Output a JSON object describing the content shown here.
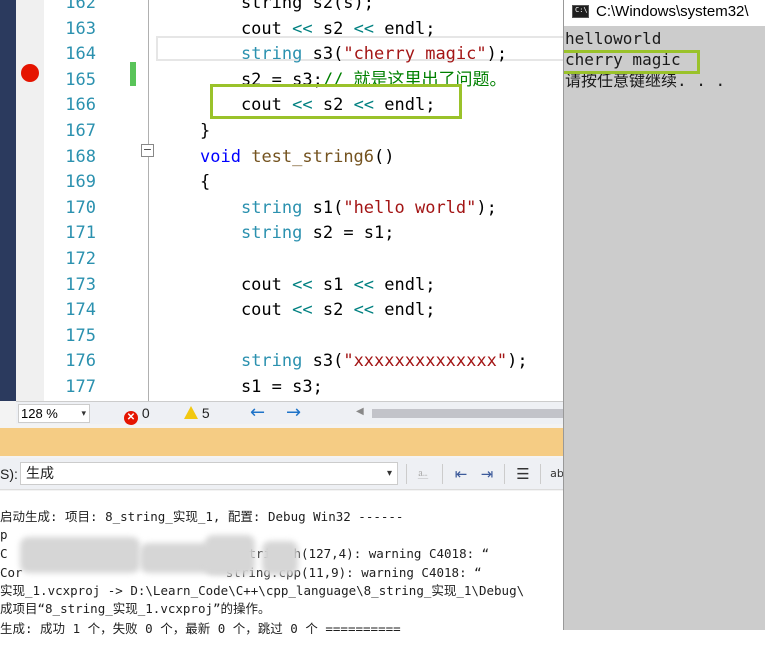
{
  "editor": {
    "line_numbers": [
      "162",
      "163",
      "164",
      "165",
      "166",
      "167",
      "168",
      "169",
      "170",
      "171",
      "172",
      "173",
      "174",
      "175",
      "176",
      "177"
    ],
    "lines": [
      [
        {
          "t": "    string s2(s);",
          "c": "cut"
        }
      ],
      [
        {
          "t": "    cout ",
          "c": ""
        },
        {
          "t": "<<",
          "c": "op"
        },
        {
          "t": " s2 ",
          "c": ""
        },
        {
          "t": "<<",
          "c": "op"
        },
        {
          "t": " endl;",
          "c": ""
        }
      ],
      [
        {
          "t": "    ",
          "c": ""
        },
        {
          "t": "string",
          "c": "ty"
        },
        {
          "t": " s3(",
          "c": ""
        },
        {
          "t": "\"cherry magic\"",
          "c": "st"
        },
        {
          "t": ");",
          "c": ""
        }
      ],
      [
        {
          "t": "    s2 = s3;",
          "c": ""
        },
        {
          "t": "// 就是这里出了问题。",
          "c": "cm"
        }
      ],
      [
        {
          "t": "    cout ",
          "c": ""
        },
        {
          "t": "<<",
          "c": "op"
        },
        {
          "t": " s2 ",
          "c": ""
        },
        {
          "t": "<<",
          "c": "op"
        },
        {
          "t": " endl;",
          "c": ""
        }
      ],
      [
        {
          "t": "}",
          "c": ""
        }
      ],
      [
        {
          "t": "void",
          "c": "kw"
        },
        {
          "t": " ",
          "c": ""
        },
        {
          "t": "test_string6",
          "c": "fn"
        },
        {
          "t": "()",
          "c": ""
        }
      ],
      [
        {
          "t": "{",
          "c": ""
        }
      ],
      [
        {
          "t": "    ",
          "c": ""
        },
        {
          "t": "string",
          "c": "ty"
        },
        {
          "t": " s1(",
          "c": ""
        },
        {
          "t": "\"hello world\"",
          "c": "st"
        },
        {
          "t": ");",
          "c": ""
        }
      ],
      [
        {
          "t": "    ",
          "c": ""
        },
        {
          "t": "string",
          "c": "ty"
        },
        {
          "t": " s2 = s1;",
          "c": ""
        }
      ],
      [
        {
          "t": "",
          "c": ""
        }
      ],
      [
        {
          "t": "    cout ",
          "c": ""
        },
        {
          "t": "<<",
          "c": "op"
        },
        {
          "t": " s1 ",
          "c": ""
        },
        {
          "t": "<<",
          "c": "op"
        },
        {
          "t": " endl;",
          "c": ""
        }
      ],
      [
        {
          "t": "    cout ",
          "c": ""
        },
        {
          "t": "<<",
          "c": "op"
        },
        {
          "t": " s2 ",
          "c": ""
        },
        {
          "t": "<<",
          "c": "op"
        },
        {
          "t": " endl;",
          "c": ""
        }
      ],
      [
        {
          "t": "",
          "c": ""
        }
      ],
      [
        {
          "t": "    ",
          "c": ""
        },
        {
          "t": "string",
          "c": "ty"
        },
        {
          "t": " s3(",
          "c": ""
        },
        {
          "t": "\"xxxxxxxxxxxxxx\"",
          "c": "st"
        },
        {
          "t": ");",
          "c": ""
        }
      ],
      [
        {
          "t": "    s1 = s3;",
          "c": ""
        }
      ]
    ],
    "breakpoint_line": "165",
    "fold_marker": "−",
    "status": {
      "zoom": "128 %",
      "zoom_dropdown": "▾",
      "errors": "0",
      "error_icon": "✕",
      "warnings": "5",
      "nav_back": "←",
      "nav_forward": "→",
      "scroll_left": "◀"
    }
  },
  "output": {
    "source_label": "S):",
    "source_value": "生成",
    "source_dropdown": "▾",
    "toolbar_icons": [
      "clear-icon",
      "find-prev-icon",
      "find-next-icon",
      "clear-all-icon",
      "word-wrap-icon"
    ],
    "lines": [
      "启动生成: 项目: 8_string_实现_1, 配置: Debug Win32 ------",
      "p",
      "C                          g   \\string.h(127,4): warning C4018: “",
      "Cor                           string.cpp(11,9): warning C4018: “",
      "实现_1.vcxproj -> D:\\Learn_Code\\C++\\cpp_language\\8_string_实现_1\\Debug\\",
      "成项目“8_string_实现_1.vcxproj”的操作。",
      "生成: 成功 1 个，失败 0 个，最新 0 个，跳过 0 个 =========="
    ]
  },
  "console": {
    "title": "C:\\Windows\\system32\\",
    "icon_text": "C:\\",
    "lines": [
      "helloworld",
      "cherry magic",
      "请按任意键继续. . ."
    ]
  },
  "colors": {
    "highlight_box": "#9ac22a",
    "breakpoint": "#e51400",
    "output_title_bar": "#f5cc84"
  }
}
